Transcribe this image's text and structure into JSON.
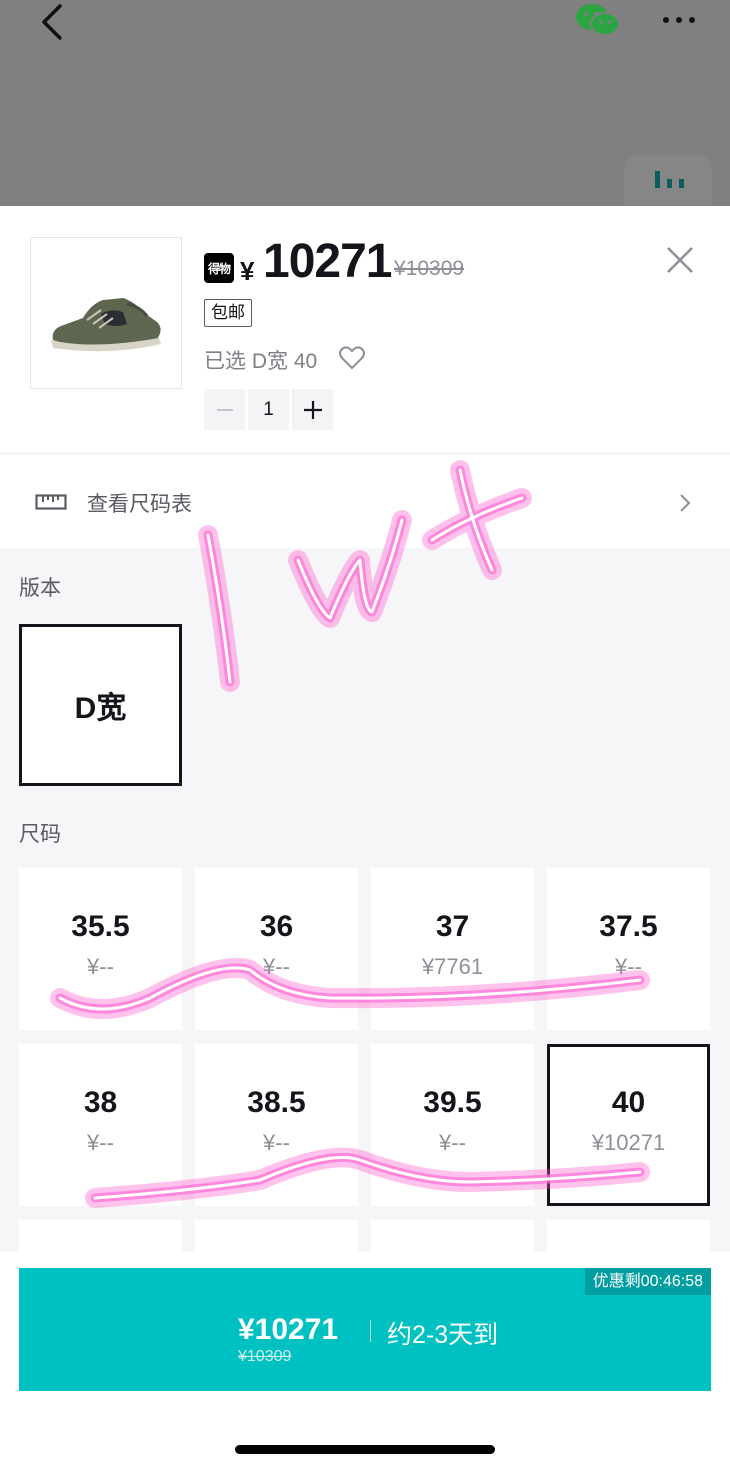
{
  "top_bar": {
    "back_icon": "chevron-left-icon",
    "share_icon": "wechat-icon",
    "more_icon": "more-dots-icon",
    "float_icon": "bars-icon"
  },
  "product": {
    "brand_logo_text": "得物",
    "currency": "¥",
    "price": "10271",
    "original_price": "¥10309",
    "free_shipping_tag": "包邮",
    "selected_text": "已选 D宽 40",
    "quantity": "1"
  },
  "size_chart": {
    "label": "查看尺码表"
  },
  "version": {
    "label": "版本",
    "options": [
      "D宽"
    ]
  },
  "size": {
    "label": "尺码",
    "options": [
      {
        "size": "35.5",
        "price": "¥--"
      },
      {
        "size": "36",
        "price": "¥--"
      },
      {
        "size": "37",
        "price": "¥7761"
      },
      {
        "size": "37.5",
        "price": "¥--"
      },
      {
        "size": "38",
        "price": "¥--"
      },
      {
        "size": "38.5",
        "price": "¥--"
      },
      {
        "size": "39.5",
        "price": "¥--"
      },
      {
        "size": "40",
        "price": "¥10271",
        "selected": true
      }
    ]
  },
  "buy_button": {
    "price": "¥10271",
    "original_price": "¥10309",
    "delivery": "约2-3天到",
    "promo_countdown": "优惠剩00:46:58"
  },
  "colors": {
    "accent": "#00c1c1",
    "promo_badge": "#009ea0",
    "handwriting": "#ff4fc8"
  }
}
